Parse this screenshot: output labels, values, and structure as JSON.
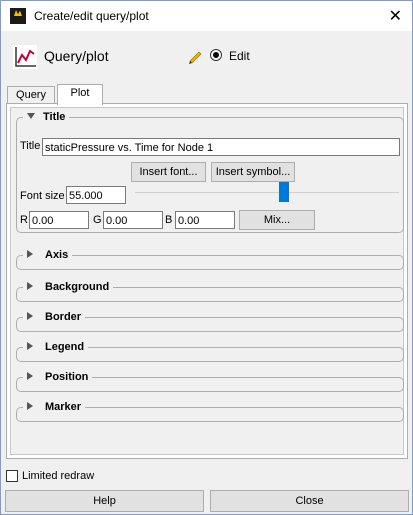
{
  "window": {
    "title": "Create/edit query/plot"
  },
  "header": {
    "title": "Query/plot",
    "mode_label": "Edit"
  },
  "tabs": [
    {
      "label": "Query"
    },
    {
      "label": "Plot"
    }
  ],
  "title_section": {
    "heading": "Title",
    "title_label": "Title",
    "title_value": "staticPressure vs. Time for Node 1",
    "insert_font": "Insert font...",
    "insert_symbol": "Insert symbol...",
    "font_size_label": "Font size",
    "font_size_value": "55.000",
    "r_label": "R",
    "r_value": "0.00",
    "g_label": "G",
    "g_value": "0.00",
    "b_label": "B",
    "b_value": "0.00",
    "mix_label": "Mix...",
    "font_size_slider_fraction": 0.56
  },
  "collapsed_sections": [
    {
      "label": "Axis"
    },
    {
      "label": "Background"
    },
    {
      "label": "Border"
    },
    {
      "label": "Legend"
    },
    {
      "label": "Position"
    },
    {
      "label": "Marker"
    }
  ],
  "footer": {
    "limited_redraw_label": "Limited redraw",
    "help_label": "Help",
    "close_label": "Close"
  },
  "colors": {
    "accent": "#0078d7",
    "border": "#adadad",
    "background": "#f0f0f0"
  },
  "icons": [
    "app-icon",
    "close-icon",
    "plot-icon",
    "pencil-icon",
    "triangle-down-icon",
    "triangle-right-icon"
  ]
}
